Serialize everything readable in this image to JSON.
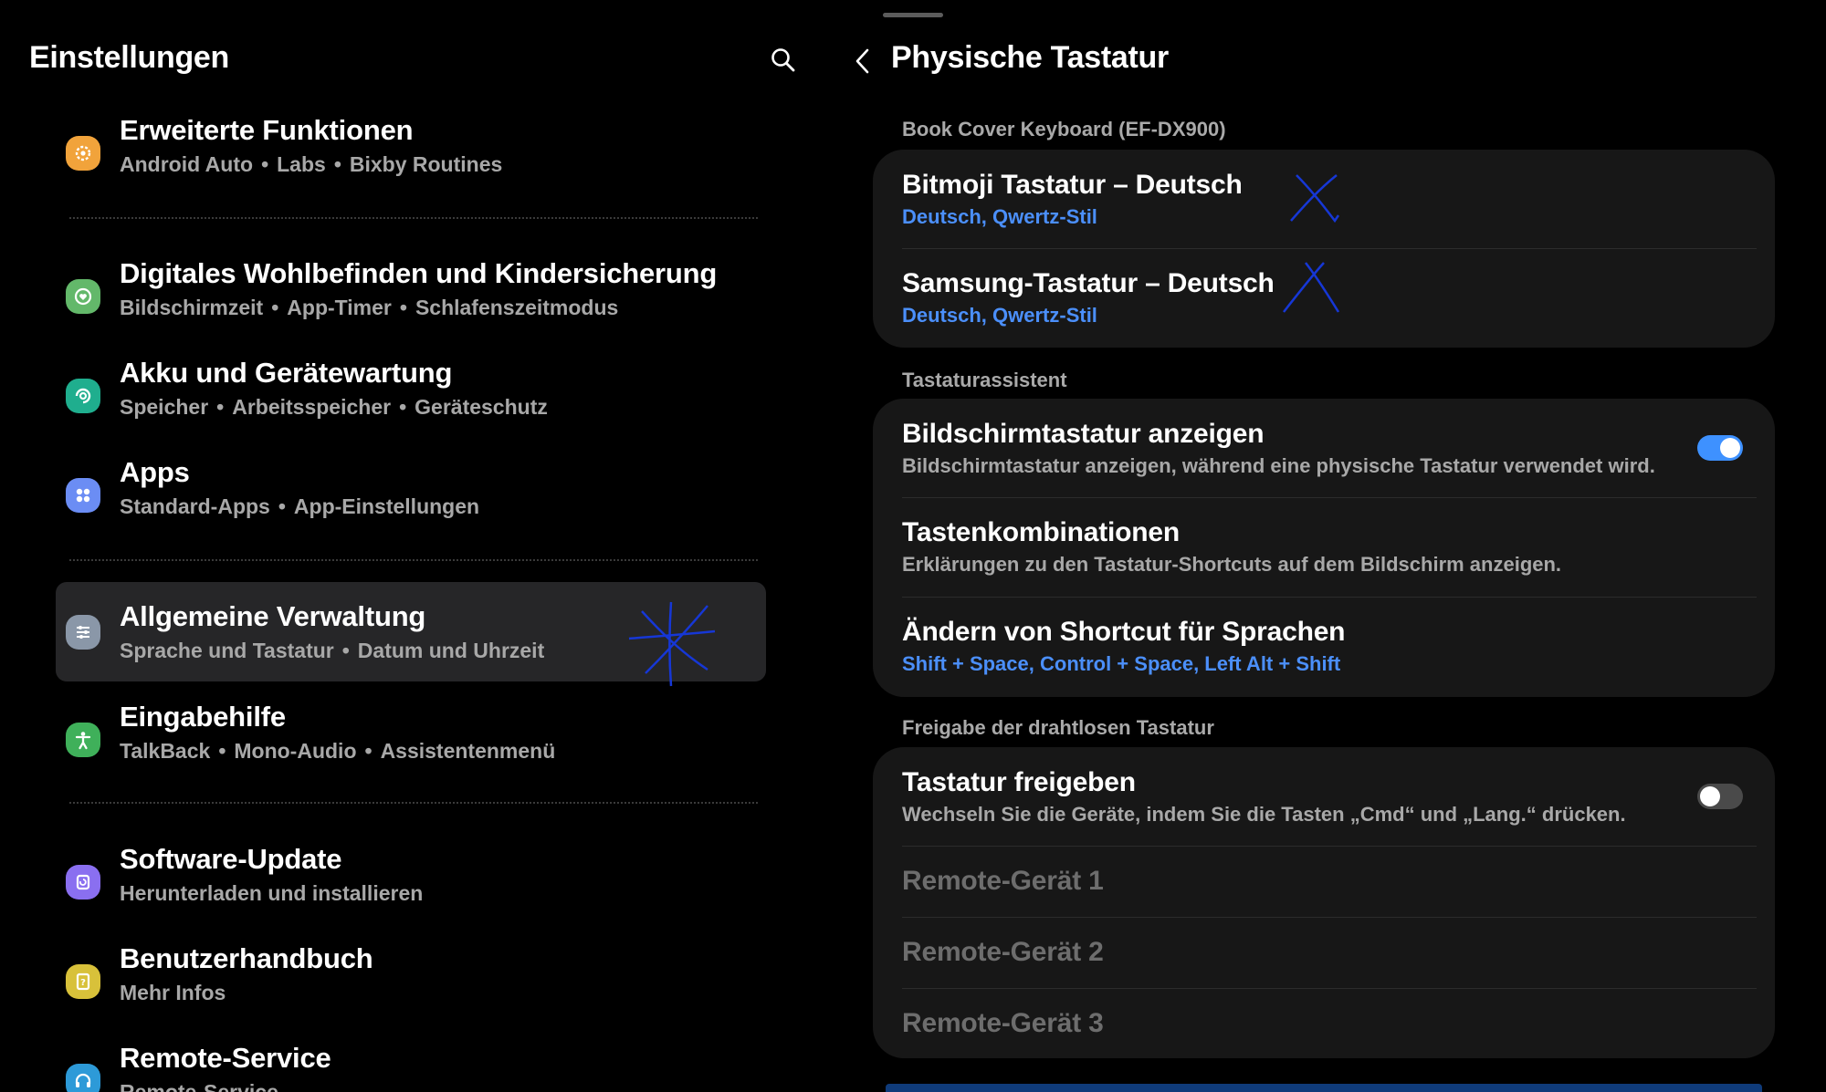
{
  "left_panel": {
    "title": "Einstellungen",
    "search_icon": "search-icon",
    "items": [
      {
        "title": "Erweiterte Funktionen",
        "subs": [
          "Android Auto",
          "Labs",
          "Bixby Routines"
        ],
        "icon": "gear-plus-icon",
        "color": "#f1a33b"
      },
      {
        "title": "Digitales Wohlbefinden und Kindersicherung",
        "subs": [
          "Bildschirmzeit",
          "App-Timer",
          "Schlafenszeitmodus"
        ],
        "icon": "heart-circle-icon",
        "color": "#63b86a"
      },
      {
        "title": "Akku und Gerätewartung",
        "subs": [
          "Speicher",
          "Arbeitsspeicher",
          "Geräteschutz"
        ],
        "icon": "refresh-circle-icon",
        "color": "#1fae8e"
      },
      {
        "title": "Apps",
        "subs": [
          "Standard-Apps",
          "App-Einstellungen"
        ],
        "icon": "grid-dots-icon",
        "color": "#6b8df4"
      },
      {
        "title": "Allgemeine Verwaltung",
        "subs": [
          "Sprache und Tastatur",
          "Datum und Uhrzeit"
        ],
        "icon": "sliders-icon",
        "color": "#8a97a8"
      },
      {
        "title": "Eingabehilfe",
        "subs": [
          "TalkBack",
          "Mono-Audio",
          "Assistentenmenü"
        ],
        "icon": "accessibility-icon",
        "color": "#3fb05a"
      },
      {
        "title": "Software-Update",
        "subs": [
          "Herunterladen und installieren"
        ],
        "icon": "update-icon",
        "color": "#8a6ff0"
      },
      {
        "title": "Benutzerhandbuch",
        "subs": [
          "Mehr Infos"
        ],
        "icon": "book-question-icon",
        "color": "#d8c13a"
      },
      {
        "title": "Remote-Service",
        "subs": [
          "Remote-Service"
        ],
        "icon": "headset-icon",
        "color": "#2d9ad8"
      }
    ]
  },
  "right_panel": {
    "title": "Physische Tastatur",
    "back_icon": "chevron-left-icon",
    "sections": {
      "device": {
        "label": "Book Cover Keyboard (EF-DX900)",
        "rows": [
          {
            "title": "Bitmoji Tastatur – Deutsch",
            "sub": "Deutsch, Qwertz-Stil"
          },
          {
            "title": "Samsung-Tastatur – Deutsch",
            "sub": "Deutsch, Qwertz-Stil"
          }
        ]
      },
      "assistant": {
        "label": "Tastaturassistent",
        "rows": [
          {
            "title": "Bildschirmtastatur anzeigen",
            "sub": "Bildschirmtastatur anzeigen, während eine physische Tastatur verwendet wird.",
            "toggle": "on"
          },
          {
            "title": "Tastenkombinationen",
            "sub": "Erklärungen zu den Tastatur-Shortcuts auf dem Bildschirm anzeigen."
          },
          {
            "title": "Ändern von Shortcut für Sprachen",
            "sub": "Shift + Space, Control + Space, Left Alt + Shift"
          }
        ]
      },
      "sharing": {
        "label": "Freigabe der drahtlosen Tastatur",
        "rows": [
          {
            "title": "Tastatur freigeben",
            "sub": "Wechseln Sie die Geräte, indem Sie die Tasten „Cmd“ und „Lang.“ drücken.",
            "toggle": "off"
          },
          {
            "title": "Remote-Gerät 1"
          },
          {
            "title": "Remote-Gerät 2"
          },
          {
            "title": "Remote-Gerät 3"
          }
        ]
      }
    }
  },
  "colors": {
    "accent_blue": "#4b8ffa",
    "toggle_on": "#3e91ff",
    "pen_ink": "#1637d6",
    "card_bg": "#171717",
    "selected_bg": "#262628"
  }
}
